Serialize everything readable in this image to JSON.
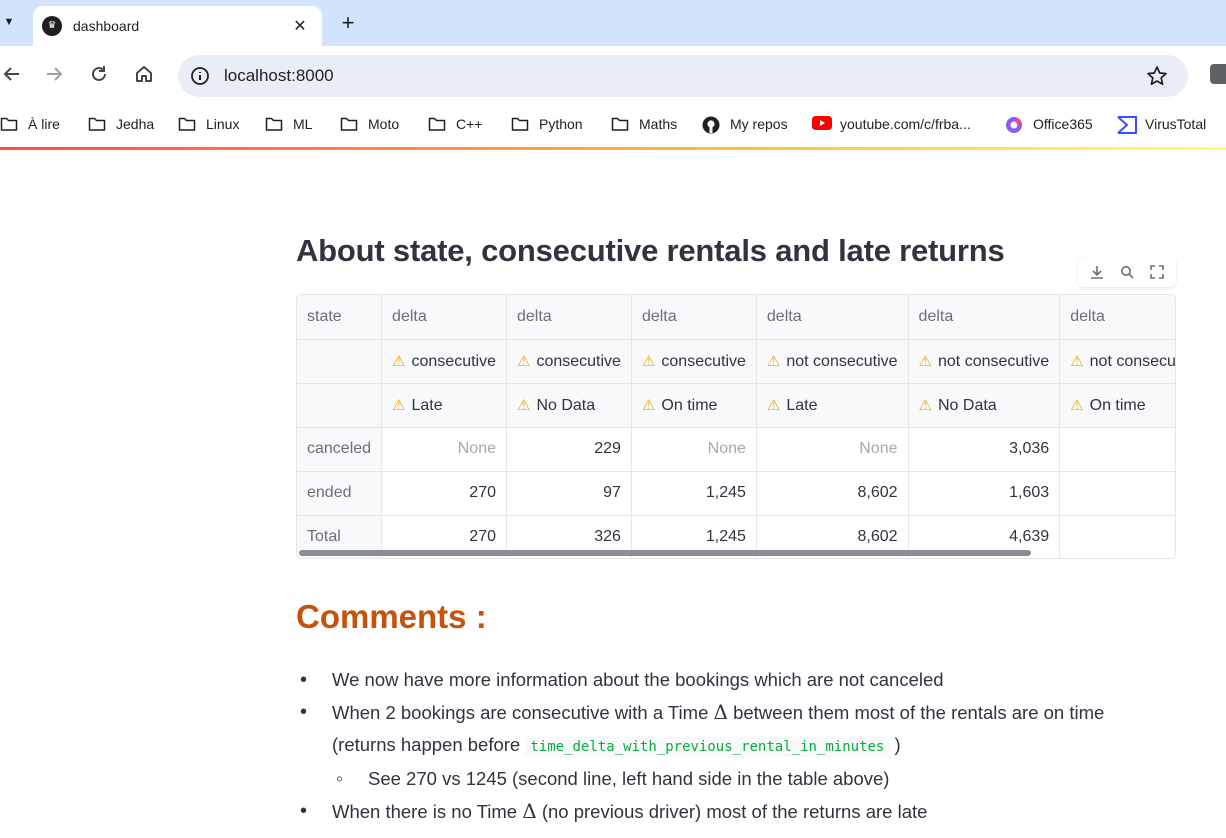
{
  "browser": {
    "tab": {
      "title": "dashboard"
    },
    "address": {
      "url": "localhost:8000"
    },
    "bookmarks": [
      {
        "label": "À lire",
        "icon": "folder-icon"
      },
      {
        "label": "Jedha",
        "icon": "folder-icon"
      },
      {
        "label": "Linux",
        "icon": "folder-icon"
      },
      {
        "label": "ML",
        "icon": "folder-icon"
      },
      {
        "label": "Moto",
        "icon": "folder-icon"
      },
      {
        "label": "C++",
        "icon": "folder-icon"
      },
      {
        "label": "Python",
        "icon": "folder-icon"
      },
      {
        "label": "Maths",
        "icon": "folder-icon"
      },
      {
        "label": "My repos",
        "icon": "github-icon"
      },
      {
        "label": "youtube.com/c/frba...",
        "icon": "youtube-icon"
      },
      {
        "label": "Office365",
        "icon": "office365-icon"
      },
      {
        "label": "VirusTotal",
        "icon": "virustotal-icon"
      }
    ]
  },
  "page": {
    "heading": "About state, consecutive rentals and late returns",
    "table": {
      "header_row1": [
        "state",
        "delta",
        "delta",
        "delta",
        "delta",
        "delta",
        "delta"
      ],
      "header_row2": [
        "",
        "consecutive",
        "consecutive",
        "consecutive",
        "not consecutive",
        "not consecutive",
        "not consecutive"
      ],
      "header_row3": [
        "",
        "Late",
        "No Data",
        "On time",
        "Late",
        "No Data",
        "On time"
      ],
      "rows": [
        {
          "label": "canceled",
          "cells": [
            "None",
            "229",
            "None",
            "None",
            "3,036",
            ""
          ]
        },
        {
          "label": "ended",
          "cells": [
            "270",
            "97",
            "1,245",
            "8,602",
            "1,603",
            ""
          ]
        },
        {
          "label": "Total",
          "cells": [
            "270",
            "326",
            "1,245",
            "8,602",
            "4,639",
            ""
          ]
        }
      ]
    },
    "comments": {
      "title": "Comments :",
      "b1": "We now have more information about the bookings which are not canceled",
      "b2_pre": "When 2 bookings are consecutive with a Time",
      "delta_symbol": "Δ",
      "b2_post": "between them most of the rentals are on time",
      "b2_line2_pre": "(returns happen before",
      "b2_code": "time_delta_with_previous_rental_in_minutes",
      "b2_line2_post": ")",
      "sub1": "See 270 vs 1245 (second line, left hand side in the table above)",
      "b3_pre": "When there is no Time",
      "b3_post": "(no previous driver) most of the returns are late"
    }
  },
  "colors": {
    "accent": "#c6530b",
    "code": "#09ab3b",
    "warning": "#f2a900"
  }
}
